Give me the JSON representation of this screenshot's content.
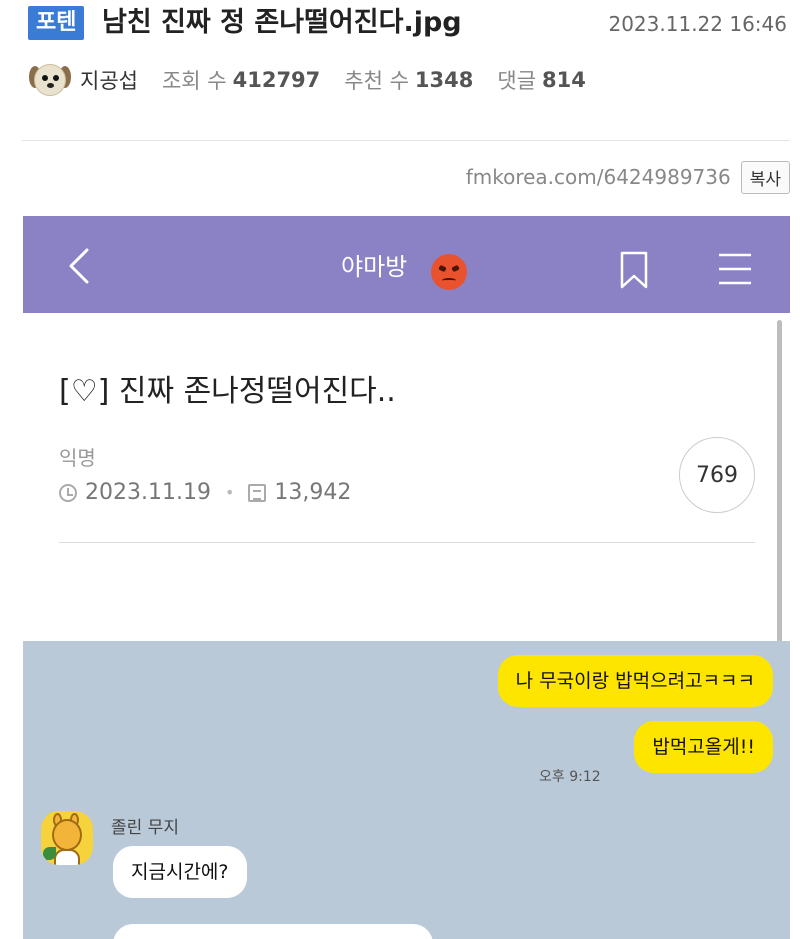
{
  "post": {
    "badge": "포텐",
    "title": "남친 진짜 정 존나떨어진다.jpg",
    "date": "2023.11.22 16:46",
    "author": "지공섭",
    "views_label": "조회 수",
    "views": "412797",
    "recommend_label": "추천 수",
    "recommend": "1348",
    "comments_label": "댓글",
    "comments": "814",
    "url": "fmkorea.com/6424989736",
    "copy_label": "복사",
    "icons": {
      "avatar": "dog-avatar-icon"
    }
  },
  "embed": {
    "app_bar": {
      "title": "야마방",
      "color": "#8a82c5",
      "icons": [
        "back-icon",
        "angry-face-icon",
        "bookmark-icon",
        "menu-icon"
      ]
    },
    "thread": {
      "title": "[♡] 진짜 존나정떨어진다..",
      "author": "익명",
      "date": "2023.11.19",
      "views": "13,942",
      "likes": "769"
    },
    "chat": {
      "background": "#b9c9d8",
      "my_bubble_color": "#fee500",
      "messages": [
        {
          "from": "me",
          "text": "나 무국이랑 밥먹으려고ㅋㅋㅋ"
        },
        {
          "from": "me",
          "text": "밥먹고올게!!"
        },
        {
          "from": "them",
          "sender": "졸린 무지",
          "text": "지금시간에?"
        },
        {
          "from": "them",
          "text": ""
        }
      ],
      "time": "오후 9:12"
    }
  }
}
